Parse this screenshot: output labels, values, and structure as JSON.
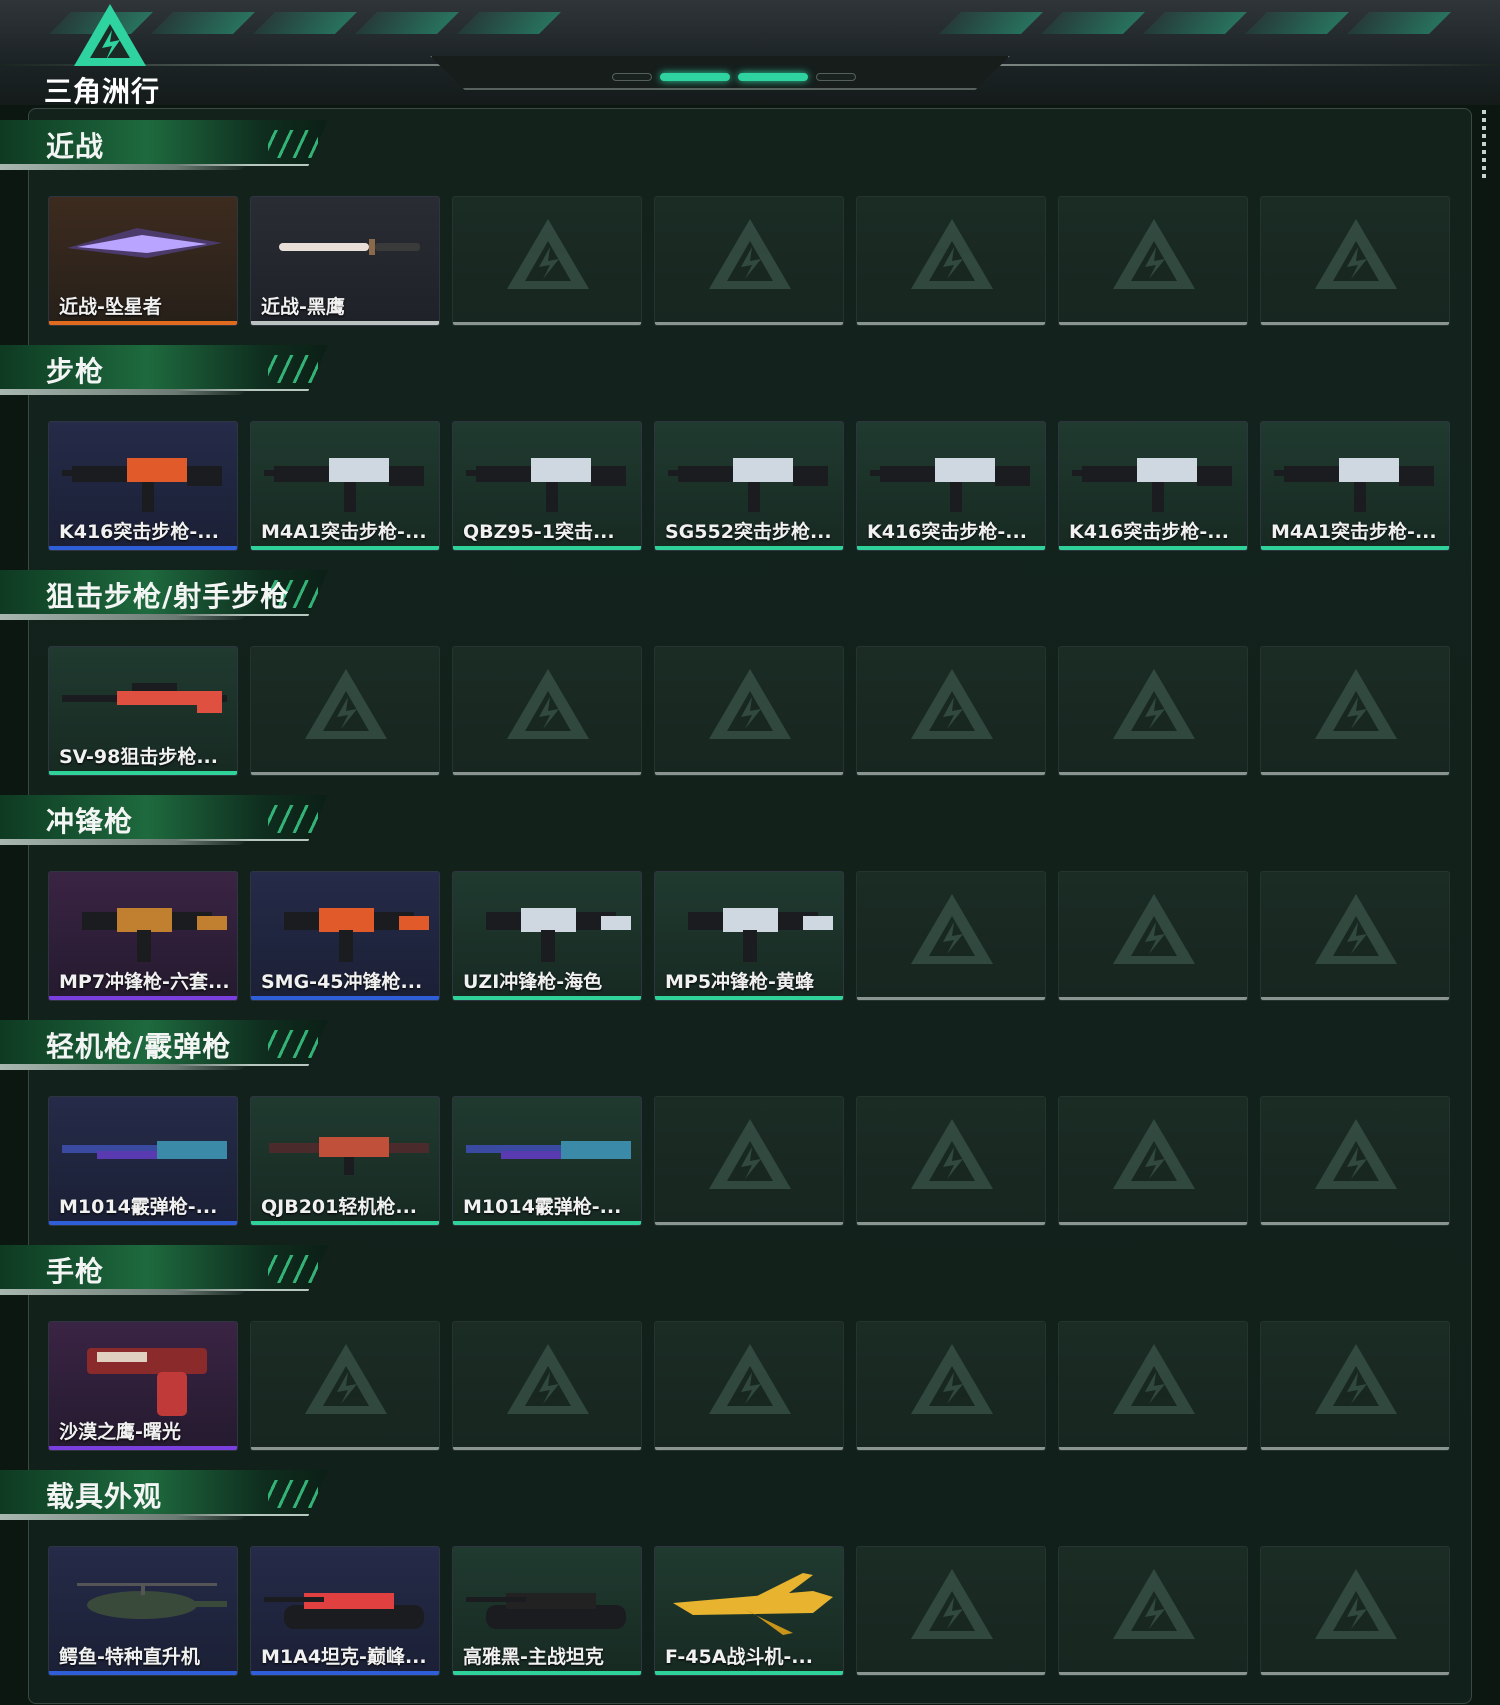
{
  "header": {
    "logo_text": "三角洲行动"
  },
  "colors": {
    "accent": "#2fd3a0",
    "rarity_orange": "#e06a1e",
    "rarity_purple": "#7b3fe0",
    "rarity_blue": "#2f5fd8",
    "rarity_green": "#2fd39a",
    "empty_bar": "#8a9490"
  },
  "sections": [
    {
      "title": "近战",
      "items": [
        {
          "name": "近战-坠星者",
          "rarity": "orange",
          "icon": "blade-icon"
        },
        {
          "name": "近战-黑鹰",
          "rarity": "none",
          "icon": "knife-icon"
        },
        null,
        null,
        null,
        null,
        null
      ]
    },
    {
      "title": "步枪",
      "items": [
        {
          "name": "K416突击步枪-...",
          "rarity": "blue",
          "icon": "rifle-icon"
        },
        {
          "name": "M4A1突击步枪-...",
          "rarity": "green",
          "icon": "rifle-icon"
        },
        {
          "name": "QBZ95-1突击...",
          "rarity": "green",
          "icon": "rifle-icon"
        },
        {
          "name": "SG552突击步枪...",
          "rarity": "green",
          "icon": "rifle-icon"
        },
        {
          "name": "K416突击步枪-...",
          "rarity": "green",
          "icon": "rifle-icon"
        },
        {
          "name": "K416突击步枪-...",
          "rarity": "green",
          "icon": "rifle-icon"
        },
        {
          "name": "M4A1突击步枪-...",
          "rarity": "green",
          "icon": "rifle-icon"
        }
      ]
    },
    {
      "title": "狙击步枪/射手步枪",
      "items": [
        {
          "name": "SV-98狙击步枪...",
          "rarity": "green",
          "icon": "sniper-icon"
        },
        null,
        null,
        null,
        null,
        null,
        null
      ]
    },
    {
      "title": "冲锋枪",
      "items": [
        {
          "name": "MP7冲锋枪-六套...",
          "rarity": "purple",
          "icon": "smg-icon"
        },
        {
          "name": "SMG-45冲锋枪...",
          "rarity": "blue",
          "icon": "smg-icon"
        },
        {
          "name": "UZI冲锋枪-海色",
          "rarity": "green",
          "icon": "smg-icon"
        },
        {
          "name": "MP5冲锋枪-黄蜂",
          "rarity": "green",
          "icon": "smg-icon"
        },
        null,
        null,
        null
      ]
    },
    {
      "title": "轻机枪/霰弹枪",
      "items": [
        {
          "name": "M1014霰弹枪-...",
          "rarity": "blue",
          "icon": "shotgun-icon"
        },
        {
          "name": "QJB201轻机枪...",
          "rarity": "green",
          "icon": "lmg-icon"
        },
        {
          "name": "M1014霰弹枪-...",
          "rarity": "green",
          "icon": "shotgun-icon"
        },
        null,
        null,
        null,
        null
      ]
    },
    {
      "title": "手枪",
      "items": [
        {
          "name": "沙漠之鹰-曙光",
          "rarity": "purple",
          "icon": "pistol-icon"
        },
        null,
        null,
        null,
        null,
        null,
        null
      ]
    },
    {
      "title": "载具外观",
      "items": [
        {
          "name": "鳄鱼-特种直升机",
          "rarity": "blue",
          "icon": "helicopter-icon"
        },
        {
          "name": "M1A4坦克-巅峰...",
          "rarity": "blue",
          "icon": "tank-icon"
        },
        {
          "name": "高雅黑-主战坦克",
          "rarity": "green",
          "icon": "tank-icon"
        },
        {
          "name": "F-45A战斗机-...",
          "rarity": "green",
          "icon": "jet-icon"
        },
        null,
        null,
        null
      ]
    }
  ]
}
